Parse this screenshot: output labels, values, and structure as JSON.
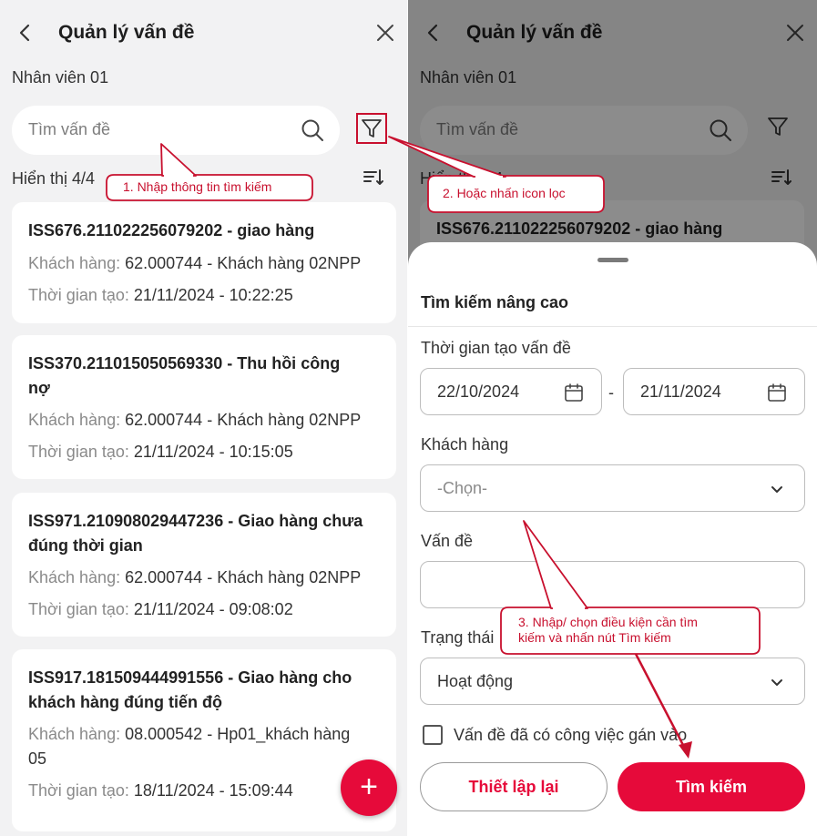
{
  "app": {
    "title": "Quản lý vấn đề",
    "employee": "Nhân viên 01",
    "search_placeholder": "Tìm vấn đề",
    "result_count": "Hiển thị 4/4"
  },
  "issues": [
    {
      "title_lines": [
        "ISS676.211022256079202 - giao hàng"
      ],
      "customer_label": "Khách hàng:",
      "customer_lines": [
        "62.000744 - Khách hàng 02NPP"
      ],
      "time_label": "Thời gian tạo:",
      "time": "21/11/2024 - 10:22:25"
    },
    {
      "title_lines": [
        "ISS370.211015050569330 - Thu  hồi công",
        "nợ"
      ],
      "customer_label": "Khách hàng:",
      "customer_lines": [
        "62.000744 - Khách hàng 02NPP"
      ],
      "time_label": "Thời gian tạo:",
      "time": "21/11/2024 - 10:15:05"
    },
    {
      "title_lines": [
        "ISS971.210908029447236 - Giao hàng chưa",
        "đúng thời gian"
      ],
      "customer_label": "Khách hàng:",
      "customer_lines": [
        "62.000744 - Khách hàng 02NPP"
      ],
      "time_label": "Thời gian tạo:",
      "time": "21/11/2024 - 09:08:02"
    },
    {
      "title_lines": [
        "ISS917.181509444991556 - Giao hàng cho",
        "khách hàng đúng tiến độ"
      ],
      "customer_label": "Khách hàng:",
      "customer_lines": [
        "08.000542 - Hp01_khách hàng",
        "05"
      ],
      "time_label": "Thời gian tạo:",
      "time": "18/11/2024 - 15:09:44"
    }
  ],
  "fab_label": "+",
  "advanced_search": {
    "title": "Tìm kiếm nâng cao",
    "date_label": "Thời gian tạo vấn đề",
    "date_from": "22/10/2024",
    "date_separator": "-",
    "date_to": "21/11/2024",
    "customer_label": "Khách hàng",
    "customer_placeholder": "-Chọn-",
    "issue_label": "Vấn đề",
    "issue_value": "",
    "status_label": "Trạng thái",
    "status_value": "Hoạt động",
    "assigned_checkbox_label": "Vấn đề đã có công việc gán vào",
    "assigned_checked": false,
    "reset_button": "Thiết lập lại",
    "search_button": "Tìm kiếm"
  },
  "annotations": {
    "step1": "1. Nhập thông tin tìm kiếm",
    "step2": "2. Hoặc nhấn icon lọc",
    "step3_lines": [
      "3. Nhập/ chọn điều kiện cần tìm",
      "kiếm và nhấn nút Tìm kiếm"
    ]
  },
  "colors": {
    "accent": "#e60a3a",
    "annotation": "#c8102e",
    "background": "#f2f2f3",
    "overlay": "rgba(0,0,0,0.45)"
  }
}
